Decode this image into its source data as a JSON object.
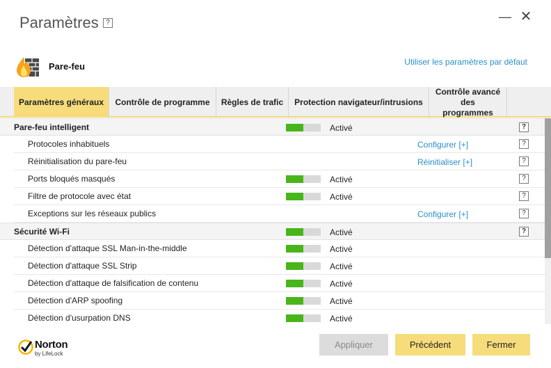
{
  "window": {
    "title": "Paramètres",
    "help_glyph": "?",
    "minimize_glyph": "—",
    "close_glyph": "✕"
  },
  "section": {
    "icon": "firewall-icon",
    "title": "Pare-feu",
    "defaults_link": "Utiliser les paramètres par défaut"
  },
  "tabs": [
    {
      "label": "Paramètres généraux",
      "active": true
    },
    {
      "label": "Contrôle de programme",
      "active": false
    },
    {
      "label": "Règles de trafic",
      "active": false
    },
    {
      "label": "Protection navigateur/intrusions",
      "active": false
    },
    {
      "label": "Contrôle avancé des programmes",
      "active": false
    }
  ],
  "rows": [
    {
      "type": "group",
      "label": "Pare-feu intelligent",
      "toggle": true,
      "toggle_on": 0.5,
      "status": "Activé",
      "help": "?"
    },
    {
      "type": "item",
      "label": "Protocoles inhabituels",
      "toggle": false,
      "action": "Configurer [+]",
      "help": "?"
    },
    {
      "type": "item",
      "label": "Réinitialisation du pare-feu",
      "toggle": false,
      "action": "Réinitialiser [+]",
      "help": "?"
    },
    {
      "type": "item",
      "label": "Ports bloqués masqués",
      "toggle": true,
      "toggle_on": 0.5,
      "status": "Activé",
      "help": "?"
    },
    {
      "type": "item",
      "label": "Filtre de protocole avec état",
      "toggle": true,
      "toggle_on": 0.5,
      "status": "Activé",
      "help": "?"
    },
    {
      "type": "item",
      "label": "Exceptions sur les réseaux publics",
      "toggle": false,
      "action": "Configurer [+]",
      "help": "?"
    },
    {
      "type": "group",
      "label": "Sécurité Wi-Fi",
      "toggle": true,
      "toggle_on": 0.5,
      "status": "Activé",
      "help": "?"
    },
    {
      "type": "item",
      "label": "Détection d'attaque SSL Man-in-the-middle",
      "toggle": true,
      "toggle_on": 0.5,
      "status": "Activé"
    },
    {
      "type": "item",
      "label": "Détection d'attaque SSL Strip",
      "toggle": true,
      "toggle_on": 0.5,
      "status": "Activé"
    },
    {
      "type": "item",
      "label": "Détection d'attaque de falsification de contenu",
      "toggle": true,
      "toggle_on": 0.5,
      "status": "Activé"
    },
    {
      "type": "item",
      "label": "Détection d'ARP spoofing",
      "toggle": true,
      "toggle_on": 0.5,
      "status": "Activé"
    },
    {
      "type": "item",
      "label": "Détection d'usurpation DNS",
      "toggle": true,
      "toggle_on": 0.5,
      "status": "Activé"
    }
  ],
  "scrollbar": {
    "position": 0.0,
    "visible_fraction": 0.68
  },
  "footer": {
    "logo_name": "Norton",
    "logo_sub": "by LifeLock",
    "apply_label": "Appliquer",
    "previous_label": "Précédent",
    "close_label": "Fermer"
  },
  "colors": {
    "accent_yellow": "#f7dc7c",
    "toggle_green": "#48b51b",
    "link_blue": "#2a8fc8",
    "disabled_gray": "#dcdcdc"
  }
}
